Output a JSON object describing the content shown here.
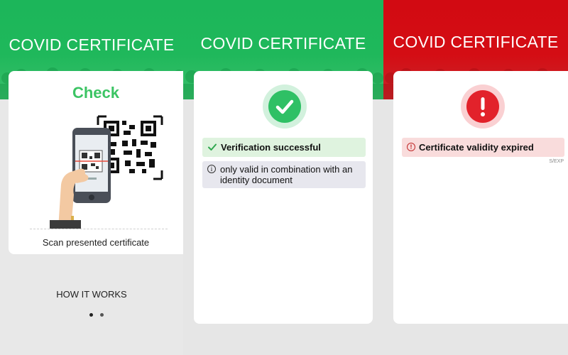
{
  "colors": {
    "success": "#2fc065",
    "error": "#e2222b",
    "header_green": "#1db954",
    "header_red": "#d20a12"
  },
  "panel_check": {
    "title": "COVID CERTIFICATE",
    "heading": "Check",
    "scan_label": "Scan presented certificate",
    "how_it_works": "HOW IT WORKS",
    "pager": {
      "pages": 2,
      "current": 1
    }
  },
  "panel_valid": {
    "title": "COVID CERTIFICATE",
    "status_icon": "check-icon",
    "success_text": "Verification successful",
    "info_text": "only valid in combination with an identity document"
  },
  "panel_invalid": {
    "title": "COVID CERTIFICATE",
    "status_icon": "exclamation-icon",
    "error_text": "Certificate validity expired",
    "code": "S/EXP"
  }
}
